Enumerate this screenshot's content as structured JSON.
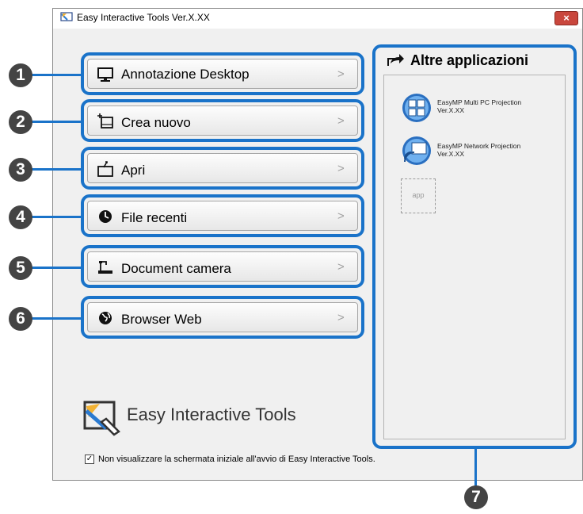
{
  "window": {
    "title": "Easy Interactive Tools Ver.X.XX",
    "close": "×"
  },
  "callouts": [
    "1",
    "2",
    "3",
    "4",
    "5",
    "6",
    "7"
  ],
  "buttons": [
    {
      "label": "Annotazione Desktop",
      "icon": "monitor-icon",
      "chevron": ">"
    },
    {
      "label": "Crea nuovo",
      "icon": "new-page-icon",
      "chevron": ">"
    },
    {
      "label": "Apri",
      "icon": "open-folder-icon",
      "chevron": ">"
    },
    {
      "label": "File recenti",
      "icon": "clock-icon",
      "chevron": ">"
    },
    {
      "label": "Document camera",
      "icon": "document-camera-icon",
      "chevron": ">"
    },
    {
      "label": "Browser Web",
      "icon": "globe-icon",
      "chevron": ">"
    }
  ],
  "other_apps": {
    "title": "Altre applicazioni",
    "items": [
      {
        "name": "EasyMP Multi PC Projection",
        "version": "Ver.X.XX"
      },
      {
        "name": "EasyMP Network Projection",
        "version": "Ver.X.XX"
      }
    ],
    "placeholder": "app"
  },
  "logo_text": "Easy Interactive Tools",
  "startup_checkbox": {
    "checked": true,
    "mark": "✓",
    "label": "Non visualizzare la schermata iniziale all'avvio di Easy Interactive Tools."
  },
  "colors": {
    "highlight": "#1a73c9",
    "callout": "#444444",
    "window_bg": "#f0f0f0"
  }
}
